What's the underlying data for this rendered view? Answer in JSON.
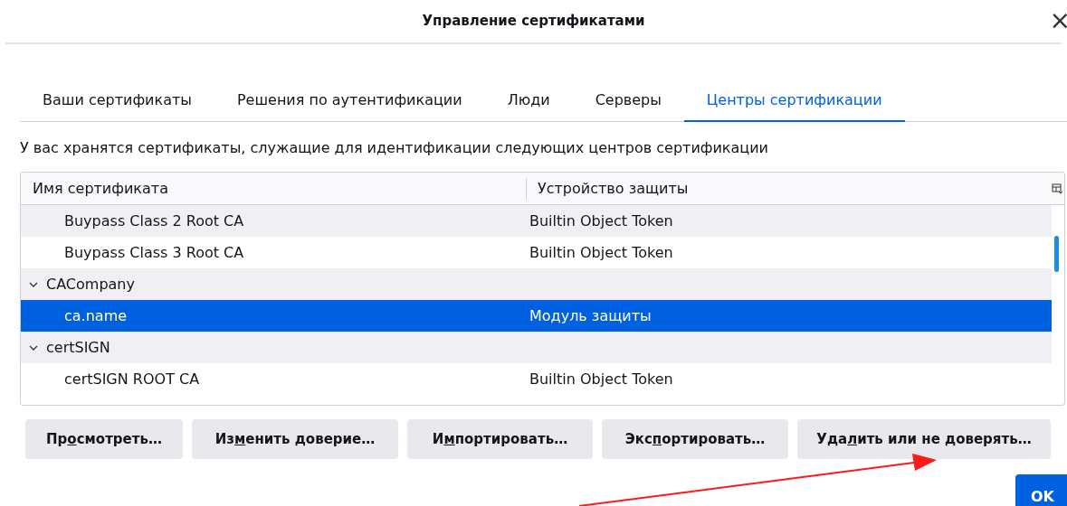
{
  "window": {
    "title": "Управление сертификатами",
    "close": "×"
  },
  "tabs": [
    {
      "label": "Ваши сертификаты",
      "selected": false
    },
    {
      "label": "Решения по аутентификации",
      "selected": false
    },
    {
      "label": "Люди",
      "selected": false
    },
    {
      "label": "Серверы",
      "selected": false
    },
    {
      "label": "Центры сертификации",
      "selected": true
    }
  ],
  "description": "У вас хранятся сертификаты, служащие для идентификации следующих центров сертификации",
  "table": {
    "columns": [
      "Имя сертификата",
      "Устройство защиты"
    ],
    "rows": [
      {
        "kind": "cert",
        "name": "Buypass Class 2 Root CA",
        "device": "Builtin Object Token",
        "selected": false
      },
      {
        "kind": "cert",
        "name": "Buypass Class 3 Root CA",
        "device": "Builtin Object Token",
        "selected": false
      },
      {
        "kind": "group",
        "name": "CACompany",
        "expanded": true,
        "children": [
          {
            "kind": "cert",
            "name": "ca.name",
            "device": "Модуль защиты",
            "selected": true
          }
        ]
      },
      {
        "kind": "group",
        "name": "certSIGN",
        "expanded": true,
        "children": [
          {
            "kind": "cert",
            "name": "certSIGN ROOT CA",
            "device": "Builtin Object Token",
            "selected": false
          }
        ]
      }
    ]
  },
  "buttons": [
    {
      "label_start": "Пр",
      "access_key": "о",
      "label_end": "смотреть…"
    },
    {
      "label_start": "Из",
      "access_key": "м",
      "label_end": "енить доверие…"
    },
    {
      "label_start": "И",
      "access_key": "м",
      "label_end": "портировать…"
    },
    {
      "label_start": "Экс",
      "access_key": "п",
      "label_end": "ортировать…"
    },
    {
      "label_start": "Уда",
      "access_key": "л",
      "label_end": "ить или не доверять…"
    }
  ],
  "ok_button": "OK"
}
